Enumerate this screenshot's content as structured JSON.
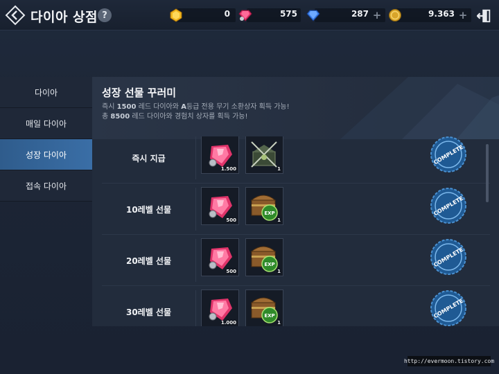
{
  "header": {
    "title": "다이아 상점",
    "help_label": "?"
  },
  "currencies": [
    {
      "icon": "yellow-gem-icon",
      "value": "0",
      "has_plus": false
    },
    {
      "icon": "red-diamond-icon",
      "value": "575",
      "has_plus": false
    },
    {
      "icon": "blue-diamond-icon",
      "value": "287",
      "has_plus": true
    },
    {
      "icon": "gold-coin-icon",
      "value": "9.363",
      "has_plus": true
    }
  ],
  "plus_label": "+",
  "sidebar": {
    "items": [
      {
        "label": "다이아",
        "active": false
      },
      {
        "label": "매일 다이아",
        "active": false
      },
      {
        "label": "성장 다이아",
        "active": true
      },
      {
        "label": "접속 다이아",
        "active": false
      }
    ]
  },
  "panel": {
    "title": "성장 선물 꾸러미",
    "desc1_pre": "즉시 ",
    "desc1_num": "1500",
    "desc1_mid": " 레드 다이아와 ",
    "desc1_grade": "A",
    "desc1_post": "등급 전용 무기 소환상자 획득 가능!",
    "desc2_pre": "총 ",
    "desc2_num": "8500",
    "desc2_post": " 레드 다이아와 경험치 상자를 획득 가능!"
  },
  "rows": [
    {
      "label": "즉시 지급",
      "item1_icon": "red-diamond-icon",
      "item1_qty": "1.500",
      "item2_icon": "weapon-chest-icon",
      "item2_qty": "1",
      "status": "COMPLETE"
    },
    {
      "label": "10레벨 선물",
      "item1_icon": "red-diamond-icon",
      "item1_qty": "500",
      "item2_icon": "exp-chest-icon",
      "item2_qty": "1",
      "status": "COMPLETE"
    },
    {
      "label": "20레벨 선물",
      "item1_icon": "red-diamond-icon",
      "item1_qty": "500",
      "item2_icon": "exp-chest-icon",
      "item2_qty": "1",
      "status": "COMPLETE"
    },
    {
      "label": "30레벨 선물",
      "item1_icon": "red-diamond-icon",
      "item1_qty": "1.000",
      "item2_icon": "exp-chest-icon",
      "item2_qty": "1",
      "status": "COMPLETE"
    }
  ],
  "exp_label": "EXP",
  "watermark": "http://evermoon.tistory.com",
  "colors": {
    "accent": "#3a6ea6",
    "red_diamond": "#e03a6a",
    "complete_badge": "#2a6fb0"
  }
}
